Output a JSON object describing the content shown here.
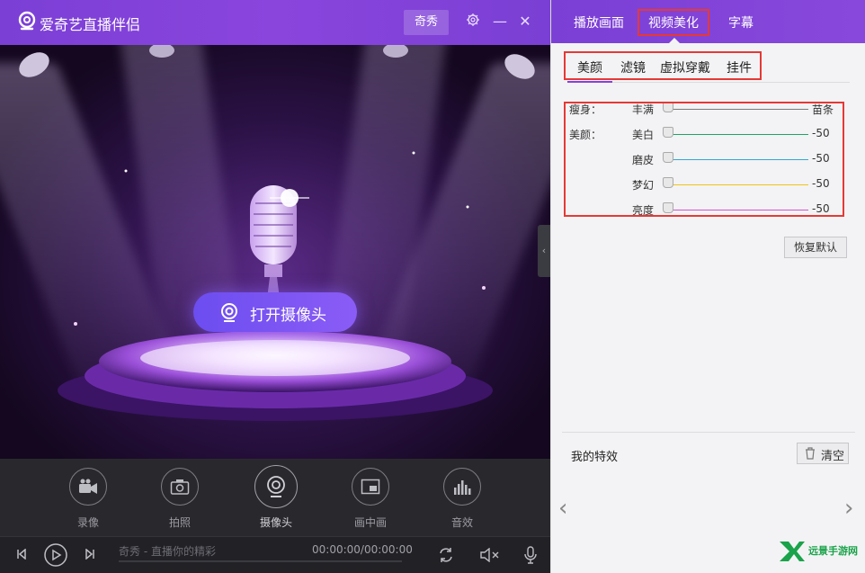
{
  "app": {
    "title": "爱奇艺直播伴侣",
    "qixiu_label": "奇秀",
    "settings_icon": "gear-icon",
    "minimize_glyph": "—",
    "close_glyph": "✕"
  },
  "stage": {
    "open_camera_label": "打开摄像头"
  },
  "toolbar": [
    {
      "key": "record",
      "label": "录像",
      "icon": "video-camera-icon"
    },
    {
      "key": "photo",
      "label": "拍照",
      "icon": "photo-camera-icon"
    },
    {
      "key": "camera",
      "label": "摄像头",
      "icon": "webcam-icon"
    },
    {
      "key": "pip",
      "label": "画中画",
      "icon": "picture-in-picture-icon"
    },
    {
      "key": "sound",
      "label": "音效",
      "icon": "equalizer-icon"
    }
  ],
  "playbar": {
    "status": "奇秀 - 直播你的精彩",
    "time": "00:00:00/00:00:00"
  },
  "right_tabs": [
    {
      "label": "播放画面"
    },
    {
      "label": "视频美化",
      "active": true
    },
    {
      "label": "字幕"
    }
  ],
  "sub_tabs": [
    {
      "label": "美颜",
      "active": true
    },
    {
      "label": "滤镜"
    },
    {
      "label": "虚拟穿戴"
    },
    {
      "label": "挂件"
    }
  ],
  "sliders": {
    "slim_group_label": "瘦身：",
    "beauty_group_label": "美颜：",
    "slim": {
      "left_label": "丰满",
      "right_label": "苗条",
      "color": "#7a7a7a"
    },
    "items": [
      {
        "label": "美白",
        "value": "-50",
        "color": "#21a366"
      },
      {
        "label": "磨皮",
        "value": "-50",
        "color": "#2fa8d9"
      },
      {
        "label": "梦幻",
        "value": "-50",
        "color": "#f0c419"
      },
      {
        "label": "亮度",
        "value": "-50",
        "color": "#d64fd6"
      }
    ]
  },
  "reset_label": "恢复默认",
  "effects": {
    "title": "我的特效",
    "clear_label": "清空"
  },
  "watermark": {
    "text": "远景手游网"
  }
}
